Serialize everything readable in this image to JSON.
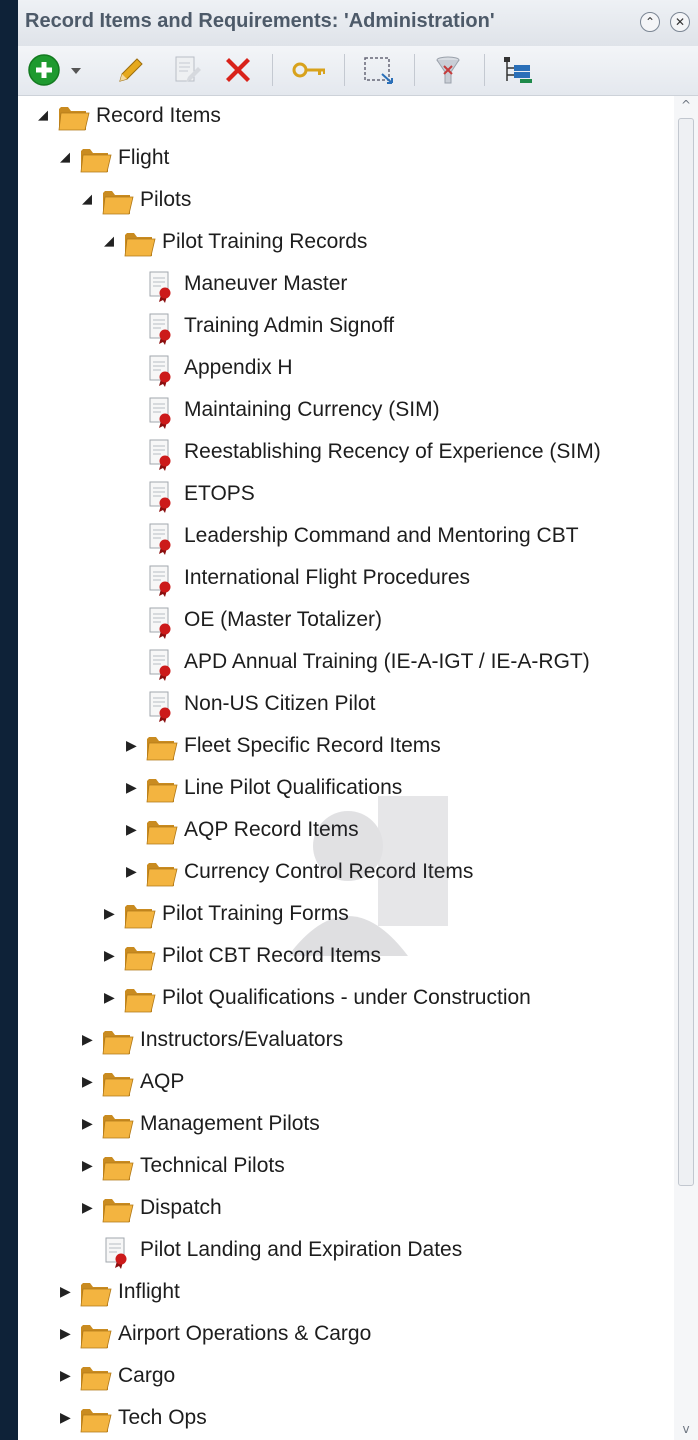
{
  "panel": {
    "title": "Record Items and Requirements: 'Administration'",
    "collapse_label": "⌃",
    "close_label": "✕"
  },
  "toolbar": {
    "tools": [
      "add-icon",
      "dropdown-arrow-icon",
      "edit-pencil-icon",
      "edit-document-icon",
      "delete-icon",
      "key-icon",
      "select-region-icon",
      "filter-icon",
      "tree-list-icon"
    ]
  },
  "tree": {
    "rows": [
      {
        "label": "Record Items",
        "type": "folder",
        "level": 0,
        "state": "expanded"
      },
      {
        "label": "Flight",
        "type": "folder",
        "level": 1,
        "state": "expanded"
      },
      {
        "label": "Pilots",
        "type": "folder",
        "level": 2,
        "state": "expanded"
      },
      {
        "label": "Pilot Training Records",
        "type": "folder",
        "level": 3,
        "state": "expanded"
      },
      {
        "label": "Maneuver Master",
        "type": "record",
        "level": 4,
        "state": "leaf"
      },
      {
        "label": "Training Admin Signoff",
        "type": "record",
        "level": 4,
        "state": "leaf"
      },
      {
        "label": "Appendix H",
        "type": "record",
        "level": 4,
        "state": "leaf"
      },
      {
        "label": "Maintaining Currency (SIM)",
        "type": "record",
        "level": 4,
        "state": "leaf"
      },
      {
        "label": "Reestablishing Recency of Experience (SIM)",
        "type": "record",
        "level": 4,
        "state": "leaf"
      },
      {
        "label": "ETOPS",
        "type": "record",
        "level": 4,
        "state": "leaf"
      },
      {
        "label": "Leadership Command and Mentoring CBT",
        "type": "record",
        "level": 4,
        "state": "leaf"
      },
      {
        "label": "International Flight Procedures",
        "type": "record",
        "level": 4,
        "state": "leaf"
      },
      {
        "label": "OE (Master Totalizer)",
        "type": "record",
        "level": 4,
        "state": "leaf"
      },
      {
        "label": "APD Annual Training (IE-A-IGT / IE-A-RGT)",
        "type": "record",
        "level": 4,
        "state": "leaf"
      },
      {
        "label": "Non-US Citizen Pilot",
        "type": "record",
        "level": 4,
        "state": "leaf"
      },
      {
        "label": "Fleet Specific Record Items",
        "type": "folder",
        "level": 4,
        "state": "collapsed"
      },
      {
        "label": "Line Pilot Qualifications",
        "type": "folder",
        "level": 4,
        "state": "collapsed"
      },
      {
        "label": "AQP Record Items",
        "type": "folder",
        "level": 4,
        "state": "collapsed"
      },
      {
        "label": "Currency Control Record Items",
        "type": "folder",
        "level": 4,
        "state": "collapsed"
      },
      {
        "label": "Pilot Training Forms",
        "type": "folder",
        "level": 3,
        "state": "collapsed"
      },
      {
        "label": "Pilot CBT Record Items",
        "type": "folder",
        "level": 3,
        "state": "collapsed"
      },
      {
        "label": "Pilot Qualifications - under Construction",
        "type": "folder",
        "level": 3,
        "state": "collapsed"
      },
      {
        "label": "Instructors/Evaluators",
        "type": "folder",
        "level": 2,
        "state": "collapsed"
      },
      {
        "label": "AQP",
        "type": "folder",
        "level": 2,
        "state": "collapsed"
      },
      {
        "label": "Management Pilots",
        "type": "folder",
        "level": 2,
        "state": "collapsed"
      },
      {
        "label": "Technical Pilots",
        "type": "folder",
        "level": 2,
        "state": "collapsed"
      },
      {
        "label": "Dispatch",
        "type": "folder",
        "level": 2,
        "state": "collapsed"
      },
      {
        "label": "Pilot Landing and Expiration Dates",
        "type": "record",
        "level": 2,
        "state": "leaf"
      },
      {
        "label": "Inflight",
        "type": "folder",
        "level": 1,
        "state": "collapsed"
      },
      {
        "label": "Airport Operations & Cargo",
        "type": "folder",
        "level": 1,
        "state": "collapsed"
      },
      {
        "label": "Cargo",
        "type": "folder",
        "level": 1,
        "state": "collapsed"
      },
      {
        "label": "Tech Ops",
        "type": "folder",
        "level": 1,
        "state": "collapsed"
      }
    ]
  },
  "scrollbar": {
    "up_label": "^",
    "down_label": "v"
  },
  "colors": {
    "folder": "#f3b440",
    "record_seal": "#cc1a1a",
    "add_green": "#1e9a2f",
    "delete_red": "#d9221a",
    "pencil": "#e6a91d"
  }
}
